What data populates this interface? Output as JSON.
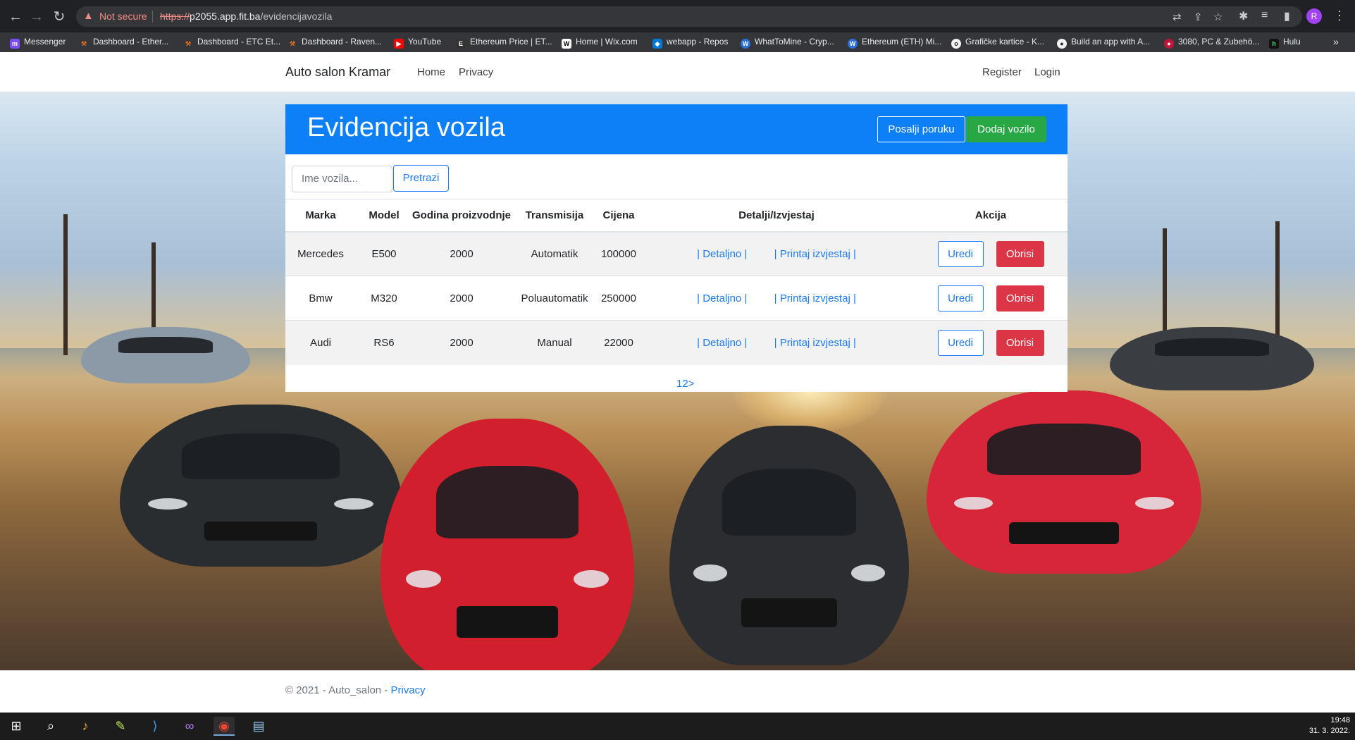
{
  "browser": {
    "security_label": "Not secure",
    "url_scheme": "https://",
    "url_host": "p2055.app.fit.ba",
    "url_path": "/evidencijavozila",
    "profile_initial": "R",
    "bookmarks": [
      {
        "label": "Messenger",
        "color": "#7b4dff"
      },
      {
        "label": "Dashboard - Ether...",
        "color": "#e8741e"
      },
      {
        "label": "Dashboard - ETC Et...",
        "color": "#e8741e"
      },
      {
        "label": "Dashboard - Raven...",
        "color": "#e8741e"
      },
      {
        "label": "YouTube",
        "color": "#ff0000"
      },
      {
        "label": "Ethereum Price | ET...",
        "color": "#333333"
      },
      {
        "label": "Home | Wix.com",
        "color": "#ffffff"
      },
      {
        "label": "webapp - Repos",
        "color": "#0078d4"
      },
      {
        "label": "WhatToMine - Cryp...",
        "color": "#2a6fdb"
      },
      {
        "label": "Ethereum (ETH) Mi...",
        "color": "#2a6fdb"
      },
      {
        "label": "Grafičke kartice - K...",
        "color": "#f2f2f2"
      },
      {
        "label": "Build an app with A...",
        "color": "#f2f2f2"
      },
      {
        "label": "3080, PC & Zubehö...",
        "color": "#c0163c"
      },
      {
        "label": "Hulu",
        "color": "#111111"
      }
    ]
  },
  "site": {
    "brand": "Auto salon Kramar",
    "nav": {
      "home": "Home",
      "privacy": "Privacy",
      "register": "Register",
      "login": "Login"
    }
  },
  "panel": {
    "title": "Evidencija vozila",
    "send_message_label": "Posalji poruku",
    "add_vehicle_label": "Dodaj vozilo",
    "search_placeholder": "Ime vozila...",
    "search_button_label": "Pretrazi"
  },
  "table": {
    "headers": [
      "Marka",
      "Model",
      "Godina proizvodnje",
      "Transmisija",
      "Cijena",
      "Detalji/Izvjestaj",
      "Akcija"
    ],
    "rows": [
      {
        "marka": "Mercedes",
        "model": "E500",
        "godina": "2000",
        "transmisija": "Automatik",
        "cijena": "100000"
      },
      {
        "marka": "Bmw",
        "model": "M320",
        "godina": "2000",
        "transmisija": "Poluautomatik",
        "cijena": "250000"
      },
      {
        "marka": "Audi",
        "model": "RS6",
        "godina": "2000",
        "transmisija": "Manual",
        "cijena": "22000"
      }
    ],
    "detail_link_label": "| Detaljno |",
    "report_link_label": "| Printaj izvjestaj |",
    "edit_label": "Uredi",
    "delete_label": "Obrisi"
  },
  "pagination": {
    "text": "12>"
  },
  "footer": {
    "copyright": "© 2021 - Auto_salon - ",
    "privacy_link": "Privacy"
  },
  "taskbar": {
    "time": "19:48",
    "date": "31. 3. 2022."
  },
  "colors": {
    "header_blue": "#0d80f8",
    "add_green": "#28a745",
    "delete_red": "#dc3545",
    "link_blue": "#1d7af3"
  }
}
